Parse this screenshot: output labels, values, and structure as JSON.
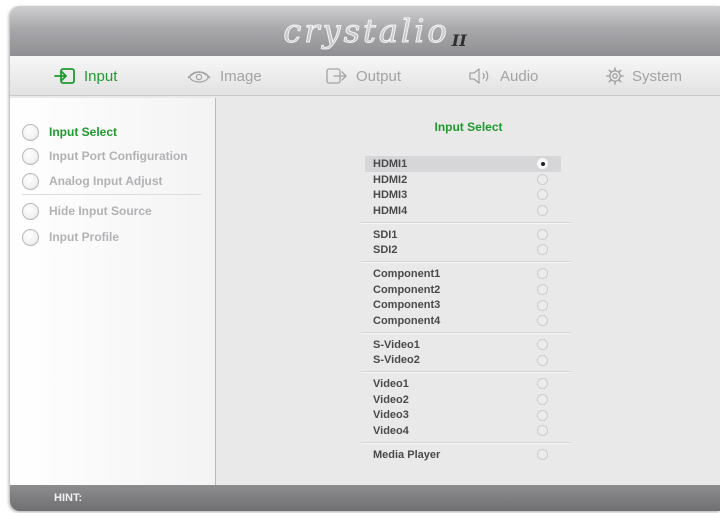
{
  "app": {
    "logo": "crystalio",
    "logo_suffix": "II"
  },
  "tabs": [
    {
      "label": "Input",
      "icon": "input-icon",
      "active": true
    },
    {
      "label": "Image",
      "icon": "eye-icon",
      "active": false
    },
    {
      "label": "Output",
      "icon": "output-icon",
      "active": false
    },
    {
      "label": "Audio",
      "icon": "speaker-icon",
      "active": false
    },
    {
      "label": "System",
      "icon": "gear-icon",
      "active": false
    }
  ],
  "sidebar": {
    "items": [
      {
        "label": "Input Select",
        "active": true
      },
      {
        "label": "Input Port Configuration",
        "active": false
      },
      {
        "label": "Analog Input Adjust",
        "active": false
      },
      {
        "label": "Hide Input Source",
        "active": false
      },
      {
        "label": "Input Profile",
        "active": false
      }
    ]
  },
  "main": {
    "title": "Input Select",
    "groups": [
      [
        "HDMI1",
        "HDMI2",
        "HDMI3",
        "HDMI4"
      ],
      [
        "SDI1",
        "SDI2"
      ],
      [
        "Component1",
        "Component2",
        "Component3",
        "Component4"
      ],
      [
        "S-Video1",
        "S-Video2"
      ],
      [
        "Video1",
        "Video2",
        "Video3",
        "Video4"
      ],
      [
        "Media Player"
      ]
    ],
    "selected": "HDMI1"
  },
  "hint": {
    "label": "HINT:"
  },
  "colors": {
    "accent": "#1f9a2e",
    "inactive_text": "#a3a3a6"
  }
}
